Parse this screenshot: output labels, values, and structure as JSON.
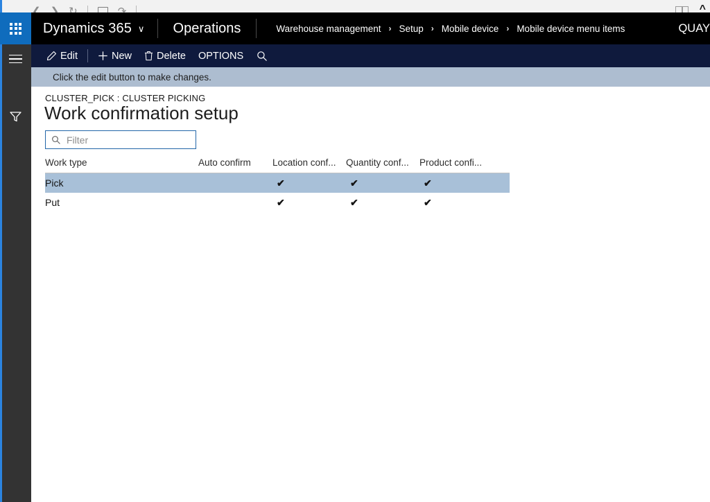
{
  "browser": {
    "back_icon": "back-arrow-icon",
    "forward_icon": "forward-arrow-icon",
    "reload_icon": "reload-icon",
    "tab_icon": "tab-icon",
    "refresh_icon": "refresh-icon",
    "reading_list_icon": "reading-list-icon",
    "collapse_icon": "collapse-chevron-icon"
  },
  "topnav": {
    "waffle_icon": "app-launcher-waffle-icon",
    "brand": "Dynamics 365",
    "brand_chevron": "∨",
    "module": "Operations",
    "breadcrumb": [
      "Warehouse management",
      "Setup",
      "Mobile device",
      "Mobile device menu items"
    ],
    "breadcrumb_separator": "›",
    "company": "QUAY"
  },
  "actionpane": {
    "edit_label": "Edit",
    "edit_icon": "pencil-icon",
    "new_label": "New",
    "new_icon": "plus-icon",
    "delete_label": "Delete",
    "delete_icon": "trash-icon",
    "options_label": "OPTIONS",
    "search_icon": "search-icon"
  },
  "messagebar": {
    "text": "Click the edit button to make changes."
  },
  "rail": {
    "menu_icon": "hamburger-menu-icon",
    "filter_icon": "funnel-filter-icon"
  },
  "page": {
    "caption": "CLUSTER_PICK : CLUSTER PICKING",
    "title": "Work confirmation setup"
  },
  "filter": {
    "icon": "search-icon",
    "placeholder": "Filter",
    "value": ""
  },
  "grid": {
    "columns": [
      "Work type",
      "Auto confirm",
      "Location conf...",
      "Quantity conf...",
      "Product confi..."
    ],
    "check_glyph": "✔",
    "rows": [
      {
        "work_type": "Pick",
        "auto_confirm": false,
        "location_confirm": true,
        "quantity_confirm": true,
        "product_confirm": true,
        "selected": true
      },
      {
        "work_type": "Put",
        "auto_confirm": false,
        "location_confirm": true,
        "quantity_confirm": true,
        "product_confirm": true,
        "selected": false
      }
    ]
  },
  "colors": {
    "topnav_bg": "#000000",
    "waffle_bg": "#0f6cbd",
    "actionpane_bg": "#0f1a3d",
    "messagebar_bg": "#adbdd0",
    "rail_bg": "#333333",
    "rail_accent": "#2b84e0",
    "row_selected_bg": "#a8c0d8",
    "filter_border": "#2266a8"
  }
}
